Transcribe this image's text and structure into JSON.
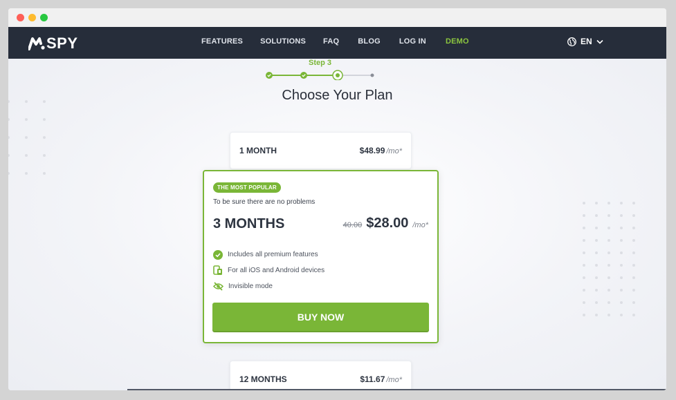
{
  "brand": {
    "logo_text": "SPY",
    "accent": "#7ab637",
    "nav_bg": "#262d3a"
  },
  "nav": {
    "links": [
      {
        "label": "FEATURES"
      },
      {
        "label": "SOLUTIONS"
      },
      {
        "label": "FAQ"
      },
      {
        "label": "BLOG"
      },
      {
        "label": "LOG IN"
      },
      {
        "label": "DEMO"
      }
    ],
    "language": "EN"
  },
  "stepper": {
    "label": "Step 3",
    "completed": 2,
    "current": 3,
    "total": 4
  },
  "heading": "Choose Your Plan",
  "plans": {
    "one_month": {
      "name": "1 MONTH",
      "price": "$48.99",
      "per": "/mo*"
    },
    "three_months": {
      "badge": "THE MOST POPULAR",
      "subtitle": "To be sure there are no problems",
      "name": "3 MONTHS",
      "old_price": "40.00",
      "price": "$28.00",
      "per": "/mo*",
      "features": [
        {
          "icon": "check-circle-icon",
          "label": "Includes all premium features"
        },
        {
          "icon": "devices-icon",
          "label": "For all iOS and Android devices"
        },
        {
          "icon": "eye-off-icon",
          "label": "Invisible mode"
        }
      ],
      "button": "BUY NOW"
    },
    "twelve_months": {
      "name": "12 MONTHS",
      "price": "$11.67",
      "per": "/mo*"
    }
  }
}
